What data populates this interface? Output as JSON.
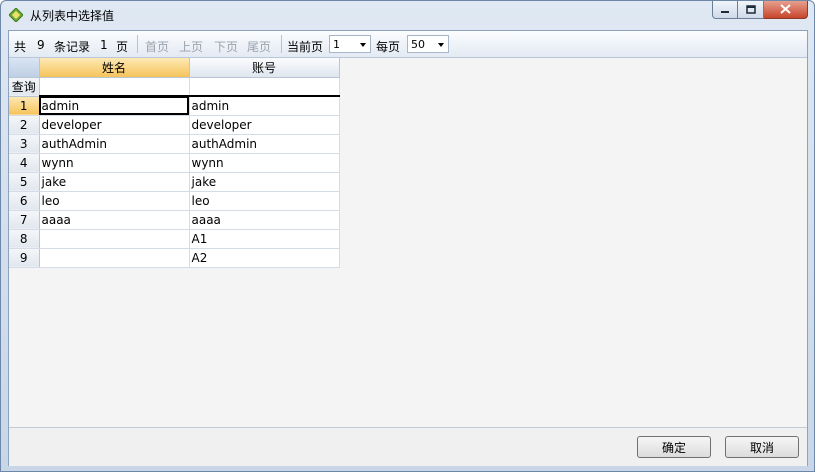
{
  "window": {
    "title": "从列表中选择值",
    "colors": {
      "accent": "#f6c35c",
      "frame": "#c8d6e7",
      "close": "#c8442c"
    },
    "icons": [
      "app-diamond-icon",
      "minimize-icon",
      "maximize-icon",
      "close-icon"
    ]
  },
  "toolbar": {
    "total_prefix": "共",
    "total_count": "9",
    "records_label": "条记录",
    "page_count": "1",
    "page_unit": "页",
    "first_page": "首页",
    "prev_page": "上页",
    "next_page": "下页",
    "last_page": "尾页",
    "current_page_label": "当前页",
    "current_page_value": "1",
    "per_page_label": "每页",
    "per_page_value": "50"
  },
  "grid": {
    "columns": [
      "姓名",
      "账号"
    ],
    "filter_label": "查询",
    "rows": [
      {
        "num": "1",
        "name": "admin",
        "account": "admin"
      },
      {
        "num": "2",
        "name": "developer",
        "account": "developer"
      },
      {
        "num": "3",
        "name": "authAdmin",
        "account": "authAdmin"
      },
      {
        "num": "4",
        "name": "wynn",
        "account": "wynn"
      },
      {
        "num": "5",
        "name": "jake",
        "account": "jake"
      },
      {
        "num": "6",
        "name": "leo",
        "account": "leo"
      },
      {
        "num": "7",
        "name": "aaaa",
        "account": "aaaa"
      },
      {
        "num": "8",
        "name": "",
        "account": "A1"
      },
      {
        "num": "9",
        "name": "",
        "account": "A2"
      }
    ]
  },
  "footer": {
    "ok_label": "确定",
    "cancel_label": "取消"
  }
}
